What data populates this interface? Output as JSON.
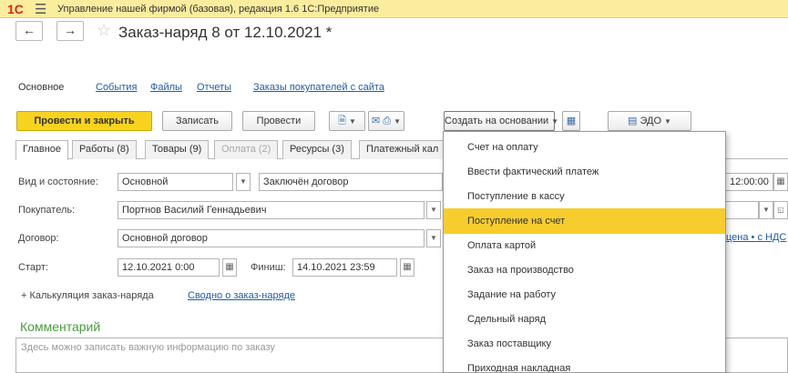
{
  "app": {
    "logo": "1С",
    "menu_icon": "hamburger-icon",
    "title": "Управление нашей фирмой (базовая), редакция 1.6 1С:Предприятие"
  },
  "nav": {
    "back_icon": "arrow-left-icon",
    "forward_icon": "arrow-right-icon",
    "back": "←",
    "forward": "→",
    "star": "☆"
  },
  "form_title": "Заказ-наряд 8 от 12.10.2021 *",
  "sections": {
    "current": "Основное",
    "links": [
      "События",
      "Файлы",
      "Отчеты",
      "Заказы покупателей с сайта"
    ]
  },
  "toolbar": {
    "post_close": "Провести и закрыть",
    "save": "Записать",
    "post": "Провести",
    "create_based": "Создать на основании",
    "edo": "ЭДО"
  },
  "tabs": [
    {
      "label": "Главное",
      "state": "active"
    },
    {
      "label": "Работы (8)",
      "state": "normal"
    },
    {
      "label": "Товары (9)",
      "state": "normal"
    },
    {
      "label": "Оплата (2)",
      "state": "disabled"
    },
    {
      "label": "Ресурсы (3)",
      "state": "normal"
    },
    {
      "label": "Платежный кал",
      "state": "normal"
    }
  ],
  "form": {
    "kind_label": "Вид и состояние:",
    "kind_value": "Основной",
    "status_value": "Заключён договор",
    "time_value": "12:00:00",
    "buyer_label": "Покупатель:",
    "buyer_value": "Портнов Василий Геннадьевич",
    "contract_label": "Договор:",
    "contract_value": "Основной договор",
    "price_link": "цена • с НДС",
    "start_label": "Старт:",
    "start_value": "12.10.2021  0:00",
    "finish_label": "Финиш:",
    "finish_value": "14.10.2021 23:59",
    "calc_label": "+ Калькуляция заказ-наряда",
    "summary_link": "Сводно о заказ-наряде"
  },
  "comment": {
    "title": "Комментарий",
    "placeholder": "Здесь можно записать важную информацию по заказу"
  },
  "dropdown": {
    "highlighted": "Поступление на счет",
    "items": [
      "Счет на оплату",
      "Ввести фактический платеж",
      "Поступление в кассу",
      "Поступление на счет",
      "Оплата картой",
      "Заказ на производство",
      "Задание на работу",
      "Сдельный наряд",
      "Заказ поставщику",
      "Приходная накладная"
    ]
  },
  "colors": {
    "title_bar": "#fbed9e",
    "primary_button": "#f7d31e",
    "highlight": "#f6cd2d",
    "link": "#215ca8",
    "comment_title": "#4a9d3a",
    "logo": "#e2231a"
  }
}
